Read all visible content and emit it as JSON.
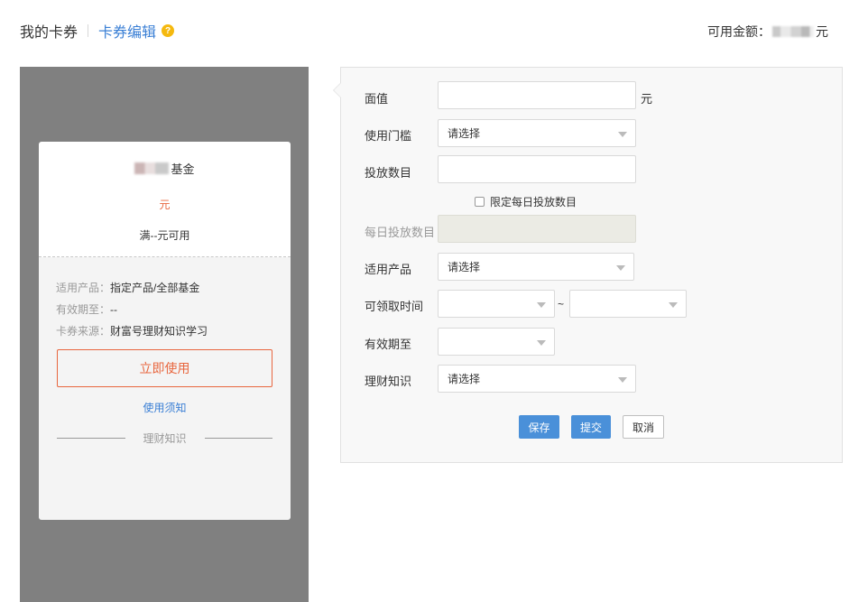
{
  "header": {
    "title": "我的卡券",
    "edit_link": "卡券编辑",
    "help_icon": "?",
    "balance_label": "可用金额：",
    "balance_unit": "元"
  },
  "preview": {
    "coupon_name_suffix": "基金",
    "value_unit": "元",
    "condition": "满--元可用",
    "product_label": "适用产品：",
    "product_value": "指定产品/全部基金",
    "expire_label": "有效期至：",
    "expire_value": "--",
    "source_label": "卡券来源：",
    "source_value": "财富号理财知识学习",
    "use_button": "立即使用",
    "notice_link": "使用须知",
    "divider_text": "理财知识"
  },
  "form": {
    "face_value_label": "面值",
    "face_value_unit": "元",
    "threshold_label": "使用门槛",
    "threshold_placeholder": "请选择",
    "quantity_label": "投放数目",
    "daily_limit_checkbox": "限定每日投放数目",
    "daily_quantity_label": "每日投放数目",
    "product_label": "适用产品",
    "product_placeholder": "请选择",
    "claim_time_label": "可领取时间",
    "claim_time_separator": "~",
    "expire_label": "有效期至",
    "knowledge_label": "理财知识",
    "knowledge_placeholder": "请选择"
  },
  "actions": {
    "save": "保存",
    "submit": "提交",
    "cancel": "取消"
  },
  "colors": {
    "accent": "#3a7fd5",
    "primary_button": "#4a90d9",
    "coupon_orange": "#e8663e",
    "help_yellow": "#f5b90f",
    "preview_bg": "#808080"
  }
}
